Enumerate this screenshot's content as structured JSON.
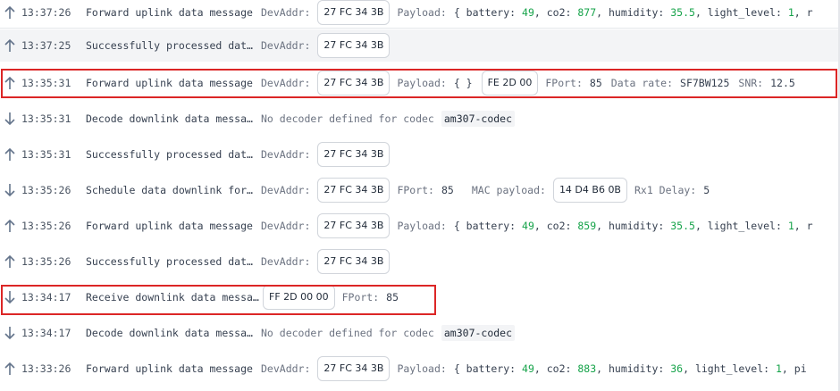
{
  "rows": [
    {
      "time": "13:37:26",
      "msg": "Forward uplink data message",
      "devaddr_label": "DevAddr:",
      "devaddr": "27 FC 34 3B",
      "payload_label": "Payload:",
      "payload_open": "{ battery:",
      "battery": "49",
      "co2_label": ", co2:",
      "co2": "877",
      "hum_label": ", humidity:",
      "humidity": "35.5",
      "light_label": ", light_level:",
      "light": "1",
      "tail": ", r"
    },
    {
      "time": "13:37:25",
      "msg": "Successfully processed dat…",
      "devaddr_label": "DevAddr:",
      "devaddr": "27 FC 34 3B"
    },
    {
      "time": "13:35:31",
      "msg": "Forward uplink data message",
      "devaddr_label": "DevAddr:",
      "devaddr": "27 FC 34 3B",
      "payload_label": "Payload:",
      "payload": "{ }",
      "data_tag": "FE 2D 00",
      "fport_label": "FPort:",
      "fport": "85",
      "dr_label": "Data rate:",
      "dr": "SF7BW125",
      "snr_label": "SNR:",
      "snr": "12.5"
    },
    {
      "time": "13:35:31",
      "msg": "Decode downlink data messa…",
      "nodecoder": "No decoder defined for codec",
      "codec": "am307-codec"
    },
    {
      "time": "13:35:31",
      "msg": "Successfully processed dat…",
      "devaddr_label": "DevAddr:",
      "devaddr": "27 FC 34 3B"
    },
    {
      "time": "13:35:26",
      "msg": "Schedule data downlink for…",
      "devaddr_label": "DevAddr:",
      "devaddr": "27 FC 34 3B",
      "fport_label": "FPort:",
      "fport": "85",
      "mac_label": "MAC payload:",
      "mac": "14 D4 B6 0B",
      "rx1_label": "Rx1 Delay:",
      "rx1": "5"
    },
    {
      "time": "13:35:26",
      "msg": "Forward uplink data message",
      "devaddr_label": "DevAddr:",
      "devaddr": "27 FC 34 3B",
      "payload_label": "Payload:",
      "payload_open": "{ battery:",
      "battery": "49",
      "co2_label": ", co2:",
      "co2": "859",
      "hum_label": ", humidity:",
      "humidity": "35.5",
      "light_label": ", light_level:",
      "light": "1",
      "tail": ", r"
    },
    {
      "time": "13:35:26",
      "msg": "Successfully processed dat…",
      "devaddr_label": "DevAddr:",
      "devaddr": "27 FC 34 3B"
    },
    {
      "time": "13:34:17",
      "msg": "Receive downlink data messa…",
      "data_tag": "FF 2D 00 00",
      "fport_label": "FPort:",
      "fport": "85"
    },
    {
      "time": "13:34:17",
      "msg": "Decode downlink data messa…",
      "nodecoder": "No decoder defined for codec",
      "codec": "am307-codec"
    },
    {
      "time": "13:33:26",
      "msg": "Forward uplink data message",
      "devaddr_label": "DevAddr:",
      "devaddr": "27 FC 34 3B",
      "payload_label": "Payload:",
      "payload_open": "{ battery:",
      "battery": "49",
      "co2_label": ", co2:",
      "co2": "883",
      "hum_label": ", humidity:",
      "humidity": "36",
      "light_label": ", light_level:",
      "light": "1",
      "tail": ", pi"
    }
  ],
  "colors": {
    "highlight": "#dc2626",
    "number": "#16a34a",
    "arrow": "#64748b"
  },
  "icons": {
    "up": "arrow-up-icon",
    "down": "arrow-down-icon"
  }
}
